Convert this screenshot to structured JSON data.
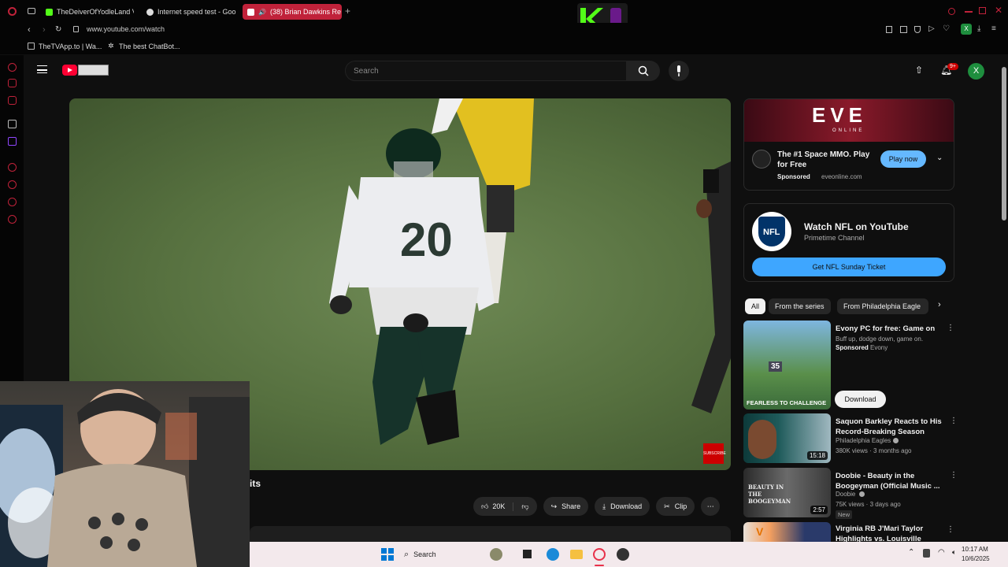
{
  "browser": {
    "tabs": [
      {
        "label": "TheDeiverOfYodleLand V",
        "fav_color": "#53fc18"
      },
      {
        "label": "Internet speed test - Goo",
        "fav_color": "#dddddd"
      },
      {
        "label": "(38) Brian Dawkins Re",
        "fav_color": "#ff0033"
      }
    ],
    "new_tab_label": "+",
    "url": "www.youtube.com/watch",
    "bookmarks": [
      "TheTVApp.to | Wa...",
      "The best ChatBot..."
    ],
    "profile_initial": "X"
  },
  "youtube": {
    "search_placeholder": "Search",
    "notification_count": "9+",
    "avatar_initial": "X",
    "title_fragment": "its",
    "subscribe_badge": "SUBSCRIBE",
    "actions": {
      "likes": "20K",
      "share": "Share",
      "download": "Download",
      "clip": "Clip"
    },
    "ad": {
      "brand": "EVE",
      "brand_sub": "ONLINE",
      "title": "The #1 Space MMO. Play for Free",
      "sponsored": "Sponsored",
      "domain": "eveonline.com",
      "cta": "Play now"
    },
    "nfl": {
      "logo_text": "NFL",
      "title": "Watch NFL on YouTube",
      "subtitle": "Primetime Channel",
      "cta": "Get NFL Sunday Ticket"
    },
    "chips": [
      "All",
      "From the series",
      "From Philadelphia Eagle"
    ],
    "recommendations": [
      {
        "title": "Evony PC for free: Game on",
        "line1": "Buff up, dodge down, game on.",
        "sponsored": "Sponsored",
        "channel": "Evony",
        "cta": "Download",
        "thumb_caption": "FEARLESS TO CHALLENGE",
        "thumb_number": "35"
      },
      {
        "title": "Saquon Barkley Reacts to His Record-Breaking Season",
        "channel": "Philadelphia Eagles",
        "meta": "380K views · 3 months ago",
        "duration": "15:18"
      },
      {
        "title": "Doobie - Beauty in the Boogeyman (Official Music ...",
        "channel": "Doobie",
        "meta": "75K views · 3 days ago",
        "badge": "New",
        "duration": "2:57",
        "thumb_caption": "BEAUTY IN THE BOOGEYMAN"
      },
      {
        "title": "Virginia RB J'Mari Taylor Highlights vs. Louisville",
        "thumb_caption": "V"
      }
    ]
  },
  "taskbar": {
    "search_label": "Search",
    "time": "10:17 AM",
    "date": "10/6/2025"
  },
  "colors": {
    "accent_red": "#c0223a",
    "youtube_red": "#ff0033",
    "play_blue": "#65b8ff",
    "nfl_blue": "#3ea6ff",
    "kick_green": "#53fc18"
  }
}
